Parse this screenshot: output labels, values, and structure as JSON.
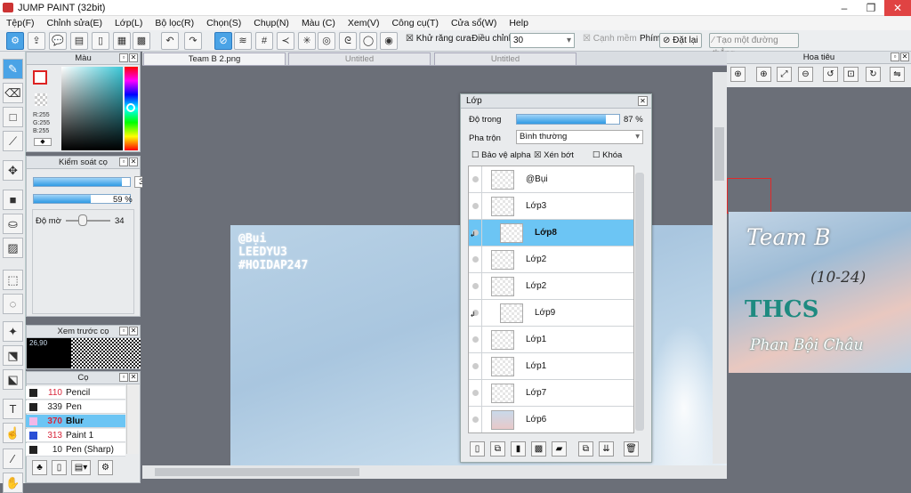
{
  "app": {
    "title": "JUMP PAINT (32bit)"
  },
  "menu": [
    "Tệp(F)",
    "Chỉnh sửa(E)",
    "Lớp(L)",
    "Bộ lọc(R)",
    "Chọn(S)",
    "Chụp(N)",
    "Màu (C)",
    "Xem(V)",
    "Công cụ(T)",
    "Cửa sổ(W)",
    "Help"
  ],
  "toolbar": {
    "antialias_label": "Khử răng cưa",
    "adjust_label": "Điều chỉnh",
    "adjust_value": "30",
    "edge_label": "Cạnh mềm",
    "key_label": "Phím",
    "reset_label": "Đặt lại",
    "line_label": "Tạo một đường thẳng"
  },
  "color_panel": {
    "title": "Màu",
    "r": "R:255",
    "g": "G:255",
    "b": "B:255"
  },
  "brush_control": {
    "title": "Kiểm soát cọ",
    "size": "370",
    "opacity": "59 %",
    "opacity_fraction": 0.59,
    "size_fraction": 0.92,
    "density_label": "Độ mờ",
    "density": "34"
  },
  "brush_preview": {
    "title": "Xem trước cọ",
    "size_text": "26,90"
  },
  "brushes": {
    "title": "Cọ",
    "items": [
      {
        "size": "110",
        "name": "Pencil",
        "color": "#222222",
        "size_color": "#d9263b"
      },
      {
        "size": "339",
        "name": "Pen",
        "color": "#222222",
        "size_color": "#222222"
      },
      {
        "size": "370",
        "name": "Blur",
        "color": "#f2b8e8",
        "size_color": "#d9263b"
      },
      {
        "size": "313",
        "name": "Paint 1",
        "color": "#2a4fd6",
        "size_color": "#d9263b"
      },
      {
        "size": "10",
        "name": "Pen (Sharp)",
        "color": "#222222",
        "size_color": "#222222"
      }
    ]
  },
  "documents": [
    {
      "name": "Team B 2.png",
      "active": true
    },
    {
      "name": "Untitled",
      "active": false
    },
    {
      "name": "Untitled",
      "active": false
    }
  ],
  "canvas_text": {
    "line1": "@Bụi",
    "line2": "LEEDYU3",
    "line3": "#HOIDAP247"
  },
  "layers_panel": {
    "title": "Lớp",
    "opacity_label": "Độ trong",
    "opacity": "87 %",
    "opacity_fraction": 0.87,
    "blend_label": "Pha trộn",
    "blend_value": "Bình thường",
    "protect_alpha": "Bảo vệ alpha",
    "clip": "Xén bớt",
    "lock": "Khóa",
    "layers": [
      {
        "name": "@Bụi",
        "selected": false,
        "clip": false
      },
      {
        "name": "Lớp3",
        "selected": false,
        "clip": false
      },
      {
        "name": "Lớp8",
        "selected": true,
        "clip": true
      },
      {
        "name": "Lớp2",
        "selected": false,
        "clip": false
      },
      {
        "name": "Lớp2",
        "selected": false,
        "clip": false
      },
      {
        "name": "Lớp9",
        "selected": false,
        "clip": true
      },
      {
        "name": "Lớp1",
        "selected": false,
        "clip": false
      },
      {
        "name": "Lớp1",
        "selected": false,
        "clip": false
      },
      {
        "name": "Lớp7",
        "selected": false,
        "clip": false
      },
      {
        "name": "Lớp6",
        "selected": false,
        "clip": false
      }
    ]
  },
  "navigator": {
    "title": "Hoa tiêu"
  },
  "preview_art": {
    "line1": "Team B",
    "line2": "(10-24)",
    "line3": "THCS",
    "line4": "Phan Bội Châu"
  },
  "colors": {
    "accent": "#4aa3e6",
    "selection": "#6cc5f4",
    "bg": "#6b6f78"
  }
}
